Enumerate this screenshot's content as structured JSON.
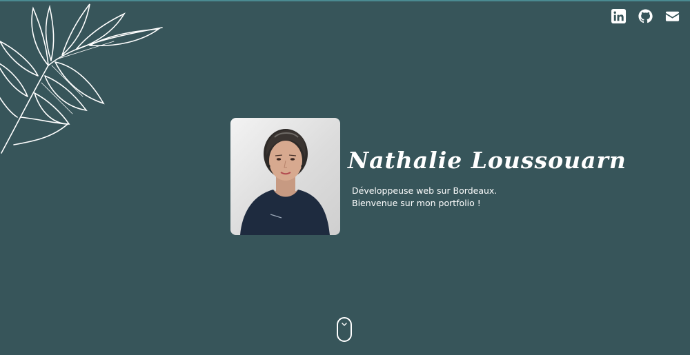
{
  "hero": {
    "name": "Nathalie Loussouarn",
    "tagline_line1": "Développeuse web sur Bordeaux.",
    "tagline_line2": "Bienvenue sur mon portfolio !",
    "photo_alt": "Portrait de Nathalie Loussouarn"
  },
  "social": [
    {
      "name": "linkedin",
      "icon": "linkedin-icon"
    },
    {
      "name": "github",
      "icon": "github-icon"
    },
    {
      "name": "email",
      "icon": "envelope-icon"
    }
  ],
  "scroll_indicator": {
    "icon": "mouse-scroll-icon"
  },
  "colors": {
    "background": "#37555a",
    "text": "#ffffff",
    "accent_line": "#4a8a91"
  }
}
